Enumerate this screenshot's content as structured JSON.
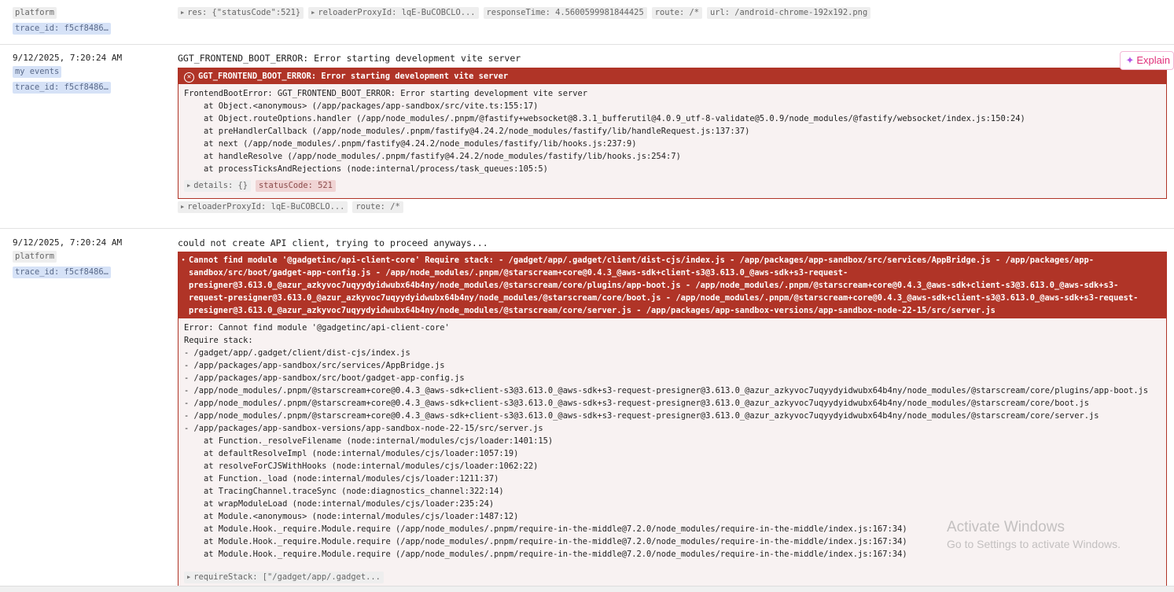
{
  "entries": [
    {
      "labels": [
        "platform"
      ],
      "trace_id": "trace_id: f5cf8486…",
      "tags": [
        {
          "text": "res: {\"statusCode\":521}",
          "expandable": true
        },
        {
          "text": "reloaderProxyId: lqE-BuCOBCLO...",
          "expandable": true
        },
        {
          "text": "responseTime: 4.5600599981844425",
          "expandable": false
        },
        {
          "text": "route: /*",
          "expandable": false
        },
        {
          "text": "url: /android-chrome-192x192.png",
          "expandable": false
        }
      ]
    },
    {
      "timestamp": "9/12/2025, 7:20:24 AM",
      "labels": [
        "my events"
      ],
      "trace_id": "trace_id: f5cf8486…",
      "message": "GGT_FRONTEND_BOOT_ERROR: Error starting development vite server",
      "error_header": "GGT_FRONTEND_BOOT_ERROR: Error starting development vite server",
      "error_body": "FrontendBootError: GGT_FRONTEND_BOOT_ERROR: Error starting development vite server\n    at Object.<anonymous> (/app/packages/app-sandbox/src/vite.ts:155:17)\n    at Object.routeOptions.handler (/app/node_modules/.pnpm/@fastify+websocket@8.3.1_bufferutil@4.0.9_utf-8-validate@5.0.9/node_modules/@fastify/websocket/index.js:150:24)\n    at preHandlerCallback (/app/node_modules/.pnpm/fastify@4.24.2/node_modules/fastify/lib/handleRequest.js:137:37)\n    at next (/app/node_modules/.pnpm/fastify@4.24.2/node_modules/fastify/lib/hooks.js:237:9)\n    at handleResolve (/app/node_modules/.pnpm/fastify@4.24.2/node_modules/fastify/lib/hooks.js:254:7)\n    at processTicksAndRejections (node:internal/process/task_queues:105:5)",
      "error_tags": [
        {
          "text": "details: {}",
          "expandable": true
        },
        {
          "text": "statusCode: 521",
          "expandable": false
        }
      ],
      "tags": [
        {
          "text": "reloaderProxyId: lqE-BuCOBCLO...",
          "expandable": true
        },
        {
          "text": "route: /*",
          "expandable": false
        }
      ],
      "explain_label": "Explain"
    },
    {
      "timestamp": "9/12/2025, 7:20:24 AM",
      "labels": [
        "platform"
      ],
      "trace_id": "trace_id: f5cf8486…",
      "message": "could not create API client, trying to proceed anyways...",
      "error_header": "Cannot find module '@gadgetinc/api-client-core' Require stack: - /gadget/app/.gadget/client/dist-cjs/index.js - /app/packages/app-sandbox/src/services/AppBridge.js - /app/packages/app-sandbox/src/boot/gadget-app-config.js - /app/node_modules/.pnpm/@starscream+core@0.4.3_@aws-sdk+client-s3@3.613.0_@aws-sdk+s3-request-presigner@3.613.0_@azur_azkyvoc7uqyydyidwubx64b4ny/node_modules/@starscream/core/plugins/app-boot.js - /app/node_modules/.pnpm/@starscream+core@0.4.3_@aws-sdk+client-s3@3.613.0_@aws-sdk+s3-request-presigner@3.613.0_@azur_azkyvoc7uqyydyidwubx64b4ny/node_modules/@starscream/core/boot.js - /app/node_modules/.pnpm/@starscream+core@0.4.3_@aws-sdk+client-s3@3.613.0_@aws-sdk+s3-request-presigner@3.613.0_@azur_azkyvoc7uqyydyidwubx64b4ny/node_modules/@starscream/core/server.js - /app/packages/app-sandbox-versions/app-sandbox-node-22-15/src/server.js",
      "error_body": "Error: Cannot find module '@gadgetinc/api-client-core'\nRequire stack:\n- /gadget/app/.gadget/client/dist-cjs/index.js\n- /app/packages/app-sandbox/src/services/AppBridge.js\n- /app/packages/app-sandbox/src/boot/gadget-app-config.js\n- /app/node_modules/.pnpm/@starscream+core@0.4.3_@aws-sdk+client-s3@3.613.0_@aws-sdk+s3-request-presigner@3.613.0_@azur_azkyvoc7uqyydyidwubx64b4ny/node_modules/@starscream/core/plugins/app-boot.js\n- /app/node_modules/.pnpm/@starscream+core@0.4.3_@aws-sdk+client-s3@3.613.0_@aws-sdk+s3-request-presigner@3.613.0_@azur_azkyvoc7uqyydyidwubx64b4ny/node_modules/@starscream/core/boot.js\n- /app/node_modules/.pnpm/@starscream+core@0.4.3_@aws-sdk+client-s3@3.613.0_@aws-sdk+s3-request-presigner@3.613.0_@azur_azkyvoc7uqyydyidwubx64b4ny/node_modules/@starscream/core/server.js\n- /app/packages/app-sandbox-versions/app-sandbox-node-22-15/src/server.js\n    at Function._resolveFilename (node:internal/modules/cjs/loader:1401:15)\n    at defaultResolveImpl (node:internal/modules/cjs/loader:1057:19)\n    at resolveForCJSWithHooks (node:internal/modules/cjs/loader:1062:22)\n    at Function._load (node:internal/modules/cjs/loader:1211:37)\n    at TracingChannel.traceSync (node:diagnostics_channel:322:14)\n    at wrapModuleLoad (node:internal/modules/cjs/loader:235:24)\n    at Module.<anonymous> (node:internal/modules/cjs/loader:1487:12)\n    at Module.Hook._require.Module.require (/app/node_modules/.pnpm/require-in-the-middle@7.2.0/node_modules/require-in-the-middle/index.js:167:34)\n    at Module.Hook._require.Module.require (/app/node_modules/.pnpm/require-in-the-middle@7.2.0/node_modules/require-in-the-middle/index.js:167:34)\n    at Module.Hook._require.Module.require (/app/node_modules/.pnpm/require-in-the-middle@7.2.0/node_modules/require-in-the-middle/index.js:167:34)",
      "error_tags": [
        {
          "text": "requireStack: [\"/gadget/app/.gadget...",
          "expandable": true
        }
      ]
    }
  ],
  "watermark": {
    "title": "Activate Windows",
    "subtitle": "Go to Settings to activate Windows."
  },
  "colors": {
    "error": "#b03427",
    "error_bg": "#f8f2f2",
    "explain": "#e0307a"
  }
}
